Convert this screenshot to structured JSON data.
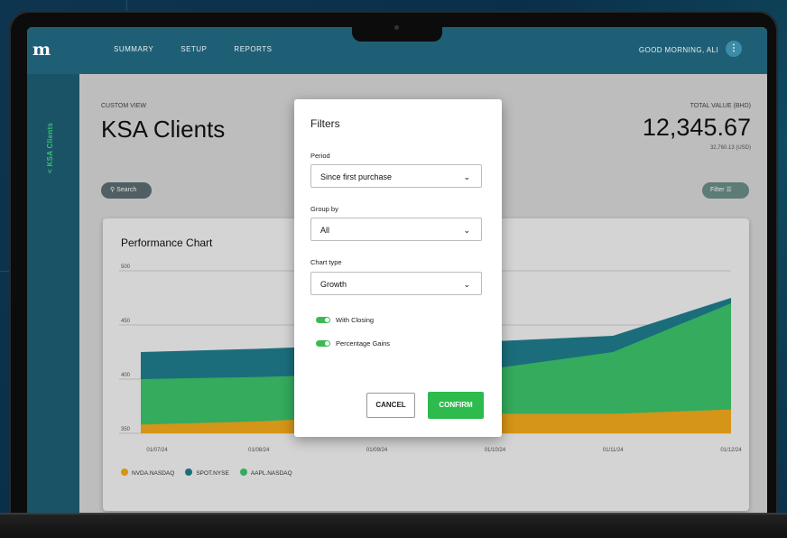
{
  "nav": {
    "logo": "m",
    "links": [
      "SUMMARY",
      "SETUP",
      "REPORTS"
    ],
    "greeting": "GOOD MORNING, ALI",
    "menu_glyph": "⋮"
  },
  "sidebar": {
    "label": "< KSA Clients"
  },
  "header": {
    "custom_view": "CUSTOM VIEW",
    "title": "KSA Clients",
    "total_label": "TOTAL VALUE (BHD)",
    "total": "12,345.67",
    "total_usd": "32,760.13 (USD)"
  },
  "search_label": "Search",
  "filter_label": "Filter",
  "chart_data": {
    "type": "area",
    "title": "Performance Chart",
    "x": [
      "01/07/24",
      "01/08/24",
      "01/09/24",
      "01/10/24",
      "01/11/24",
      "01/12/24"
    ],
    "yticks": [
      350,
      400,
      450,
      500
    ],
    "ylim": [
      350,
      500
    ],
    "stacked": true,
    "series": [
      {
        "name": "NVDA.NASDAQ",
        "color": "#f2aa1c",
        "values": [
          358,
          361,
          366,
          368,
          368,
          372
        ]
      },
      {
        "name": "AAPL.NASDAQ",
        "color": "#3cc36a",
        "values": [
          400,
          402,
          405,
          410,
          425,
          470
        ]
      },
      {
        "name": "SPOT.NYSE",
        "color": "#1f7d8e",
        "values": [
          425,
          428,
          432,
          435,
          440,
          475
        ]
      }
    ]
  },
  "filters": {
    "title": "Filters",
    "period_label": "Period",
    "period_value": "Since first purchase",
    "group_label": "Group by",
    "group_value": "All",
    "charttype_label": "Chart type",
    "charttype_value": "Growth",
    "toggle1": "With Closing",
    "toggle2": "Percentage Gains",
    "cancel": "CANCEL",
    "confirm": "CONFIRM"
  }
}
